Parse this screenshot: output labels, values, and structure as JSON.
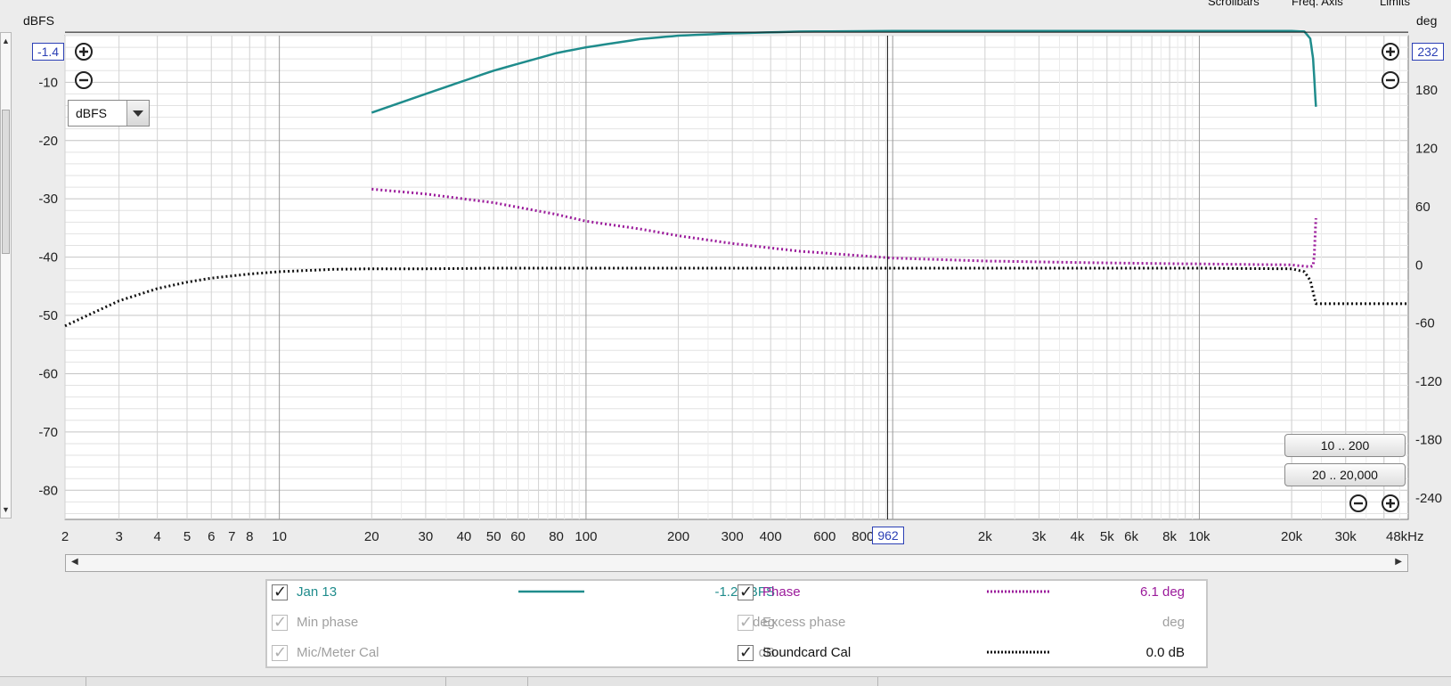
{
  "top_menu": {
    "items": [
      "Scrollbars",
      "Freq. Axis",
      "Limits"
    ]
  },
  "y_left_unit": "dBFS",
  "y_right_unit": "deg",
  "unit_selector": {
    "value": "dBFS"
  },
  "cursor": {
    "left_readout": "-1.4",
    "right_readout": "232",
    "freq_readout": "962"
  },
  "range_buttons": [
    "10 .. 200",
    "20 .. 20,000"
  ],
  "colors": {
    "spl": "#1f8c8c",
    "phase": "#9b1b9b",
    "soundcard": "#111111",
    "cursor_box": "#2b3fb5"
  },
  "chart_data": {
    "type": "line",
    "x_scale": "log",
    "xlim": [
      2,
      48000
    ],
    "xlabel": "",
    "ylabel": "dBFS",
    "ylabel_right": "deg",
    "ylim": [
      -85,
      -2
    ],
    "ylim_right": [
      -262,
      236
    ],
    "x_tick_labels": [
      "2",
      "3",
      "4",
      "5",
      "6",
      "7",
      "8",
      "10",
      "20",
      "30",
      "40",
      "50",
      "60",
      "80",
      "100",
      "200",
      "300",
      "400",
      "600",
      "800",
      "2k",
      "3k",
      "4k",
      "5k",
      "6k",
      "8k",
      "10k",
      "20k",
      "30k",
      "48kHz"
    ],
    "x_tick_values": [
      2,
      3,
      4,
      5,
      6,
      7,
      8,
      10,
      20,
      30,
      40,
      50,
      60,
      80,
      100,
      200,
      300,
      400,
      600,
      800,
      2000,
      3000,
      4000,
      5000,
      6000,
      8000,
      10000,
      20000,
      30000,
      48000
    ],
    "y_ticks_left": [
      -10,
      -20,
      -30,
      -40,
      -50,
      -60,
      -70,
      -80
    ],
    "y_ticks_right": [
      180,
      120,
      60,
      0,
      -60,
      -120,
      -180,
      -240
    ],
    "grid": true,
    "series": [
      {
        "name": "Jan 13",
        "axis": "left",
        "style": "solid",
        "x": [
          20,
          30,
          50,
          80,
          100,
          150,
          200,
          300,
          500,
          1000,
          2000,
          5000,
          10000,
          20000,
          22000,
          23000,
          23500,
          24000
        ],
        "y": [
          -15.2,
          -12,
          -8,
          -5,
          -4,
          -2.6,
          -2,
          -1.6,
          -1.3,
          -1.2,
          -1.2,
          -1.2,
          -1.2,
          -1.2,
          -1.3,
          -2.5,
          -6,
          -14.2
        ]
      },
      {
        "name": "Phase",
        "axis": "right",
        "style": "dotted",
        "x": [
          20,
          30,
          50,
          80,
          100,
          150,
          200,
          300,
          500,
          1000,
          2000,
          5000,
          10000,
          20000,
          23000,
          23500,
          23700,
          24000
        ],
        "y": [
          78,
          73,
          64,
          52,
          45,
          37,
          30,
          22,
          14,
          7,
          4,
          2,
          1,
          0,
          -2,
          -1,
          10,
          48
        ]
      },
      {
        "name": "Soundcard Cal",
        "axis": "left",
        "style": "dotted",
        "x": [
          2,
          3,
          4,
          5,
          6,
          8,
          10,
          15,
          20,
          30,
          50,
          100,
          1000,
          10000,
          20000,
          22000,
          23000,
          24000,
          48000
        ],
        "y": [
          -51.8,
          -47.5,
          -45.4,
          -44.3,
          -43.6,
          -42.9,
          -42.5,
          -42.1,
          -42,
          -42,
          -41.9,
          -41.9,
          -41.9,
          -41.9,
          -42,
          -42.5,
          -44,
          -48,
          -48
        ]
      }
    ]
  },
  "legend": {
    "rows": [
      {
        "label": "Jan 13",
        "value": "-1.2 dBFS",
        "enabled": true,
        "color": "#1f8c8c",
        "style": "solid"
      },
      {
        "label": "Phase",
        "value": "6.1 deg",
        "enabled": true,
        "color": "#9b1b9b",
        "style": "dotted"
      },
      {
        "label": "Min phase",
        "value": "deg",
        "enabled": false
      },
      {
        "label": "Excess phase",
        "value": "deg",
        "enabled": false
      },
      {
        "label": "Mic/Meter Cal",
        "value": "dB",
        "enabled": false
      },
      {
        "label": "Soundcard Cal",
        "value": "0.0 dB",
        "enabled": true,
        "color": "#111111",
        "style": "dotted"
      }
    ]
  }
}
